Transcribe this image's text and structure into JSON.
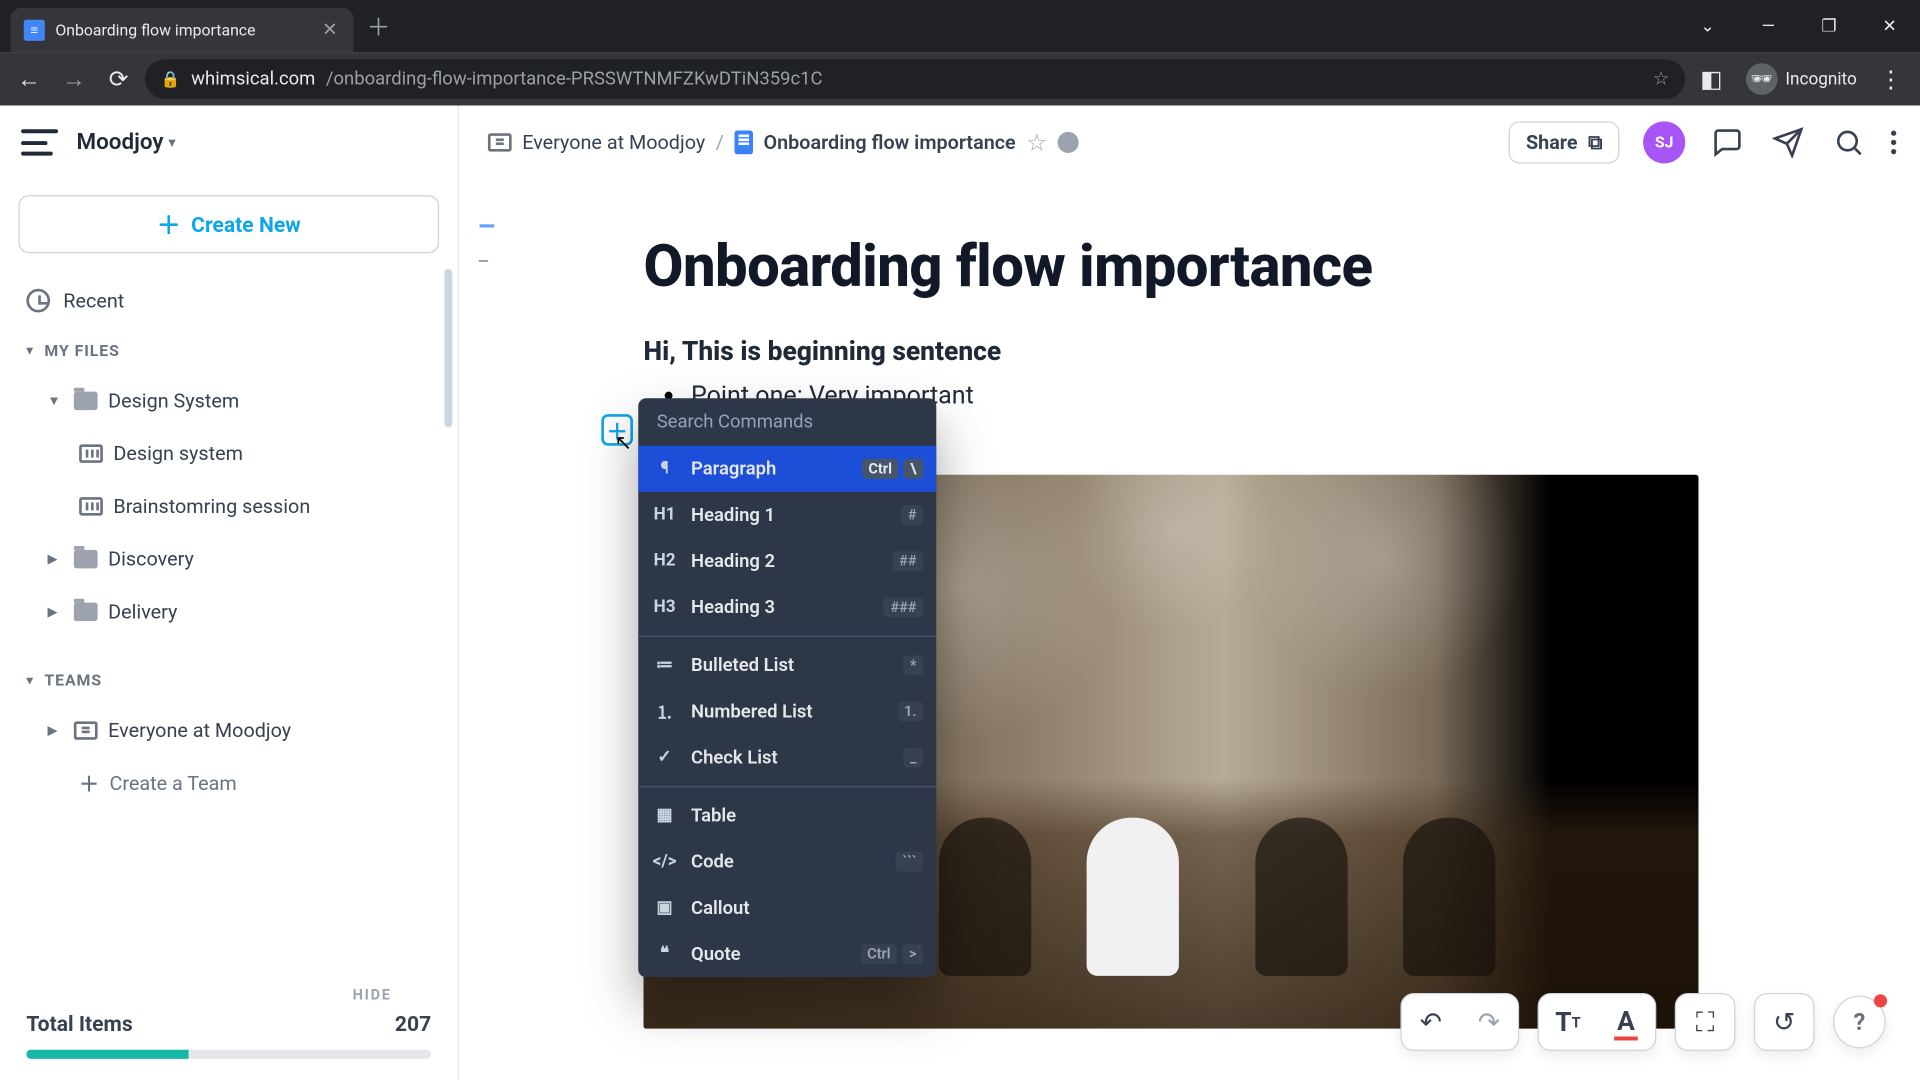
{
  "browser": {
    "tab_title": "Onboarding flow importance",
    "url_domain": "whimsical.com",
    "url_path": "/onboarding-flow-importance-PRSSWTNMFZKwDTiN359c1C",
    "incognito_label": "Incognito"
  },
  "workspace": {
    "name": "Moodjoy"
  },
  "sidebar": {
    "create_label": "Create New",
    "recent_label": "Recent",
    "section_files": "MY FILES",
    "section_teams": "TEAMS",
    "files": {
      "design_system_folder": "Design System",
      "design_system_board": "Design system",
      "brainstorming": "Brainstomring session",
      "discovery": "Discovery",
      "delivery": "Delivery"
    },
    "teams": {
      "everyone": "Everyone at Moodjoy",
      "create_team": "Create a Team"
    },
    "hide_label": "HIDE",
    "total_label": "Total Items",
    "total_value": "207"
  },
  "breadcrumb": {
    "team": "Everyone at Moodjoy",
    "doc": "Onboarding flow importance"
  },
  "header": {
    "share": "Share",
    "avatar": "SJ"
  },
  "doc": {
    "title": "Onboarding flow importance",
    "subline": "Hi, This is beginning sentence",
    "bullet1": "Point one: Very important"
  },
  "slashmenu": {
    "placeholder": "Search Commands",
    "items": [
      {
        "icon": "¶",
        "label": "Paragraph",
        "shortcut": [
          "Ctrl",
          "\\"
        ],
        "selected": true
      },
      {
        "icon": "H1",
        "label": "Heading 1",
        "shortcut": [
          "#"
        ]
      },
      {
        "icon": "H2",
        "label": "Heading 2",
        "shortcut": [
          "##"
        ]
      },
      {
        "icon": "H3",
        "label": "Heading 3",
        "shortcut": [
          "###"
        ]
      },
      {
        "icon": "≔",
        "label": "Bulleted List",
        "shortcut": [
          "*"
        ],
        "group": 2
      },
      {
        "icon": "⒈",
        "label": "Numbered List",
        "shortcut": [
          "1."
        ],
        "group": 2
      },
      {
        "icon": "✓",
        "label": "Check List",
        "shortcut": [
          "_"
        ],
        "group": 2
      },
      {
        "icon": "▦",
        "label": "Table",
        "shortcut": [],
        "group": 3
      },
      {
        "icon": "</>",
        "label": "Code",
        "shortcut": [
          "```"
        ],
        "group": 3
      },
      {
        "icon": "▣",
        "label": "Callout",
        "shortcut": [],
        "group": 3
      },
      {
        "icon": "❝",
        "label": "Quote",
        "shortcut": [
          "Ctrl",
          ">"
        ],
        "group": 3
      }
    ]
  }
}
